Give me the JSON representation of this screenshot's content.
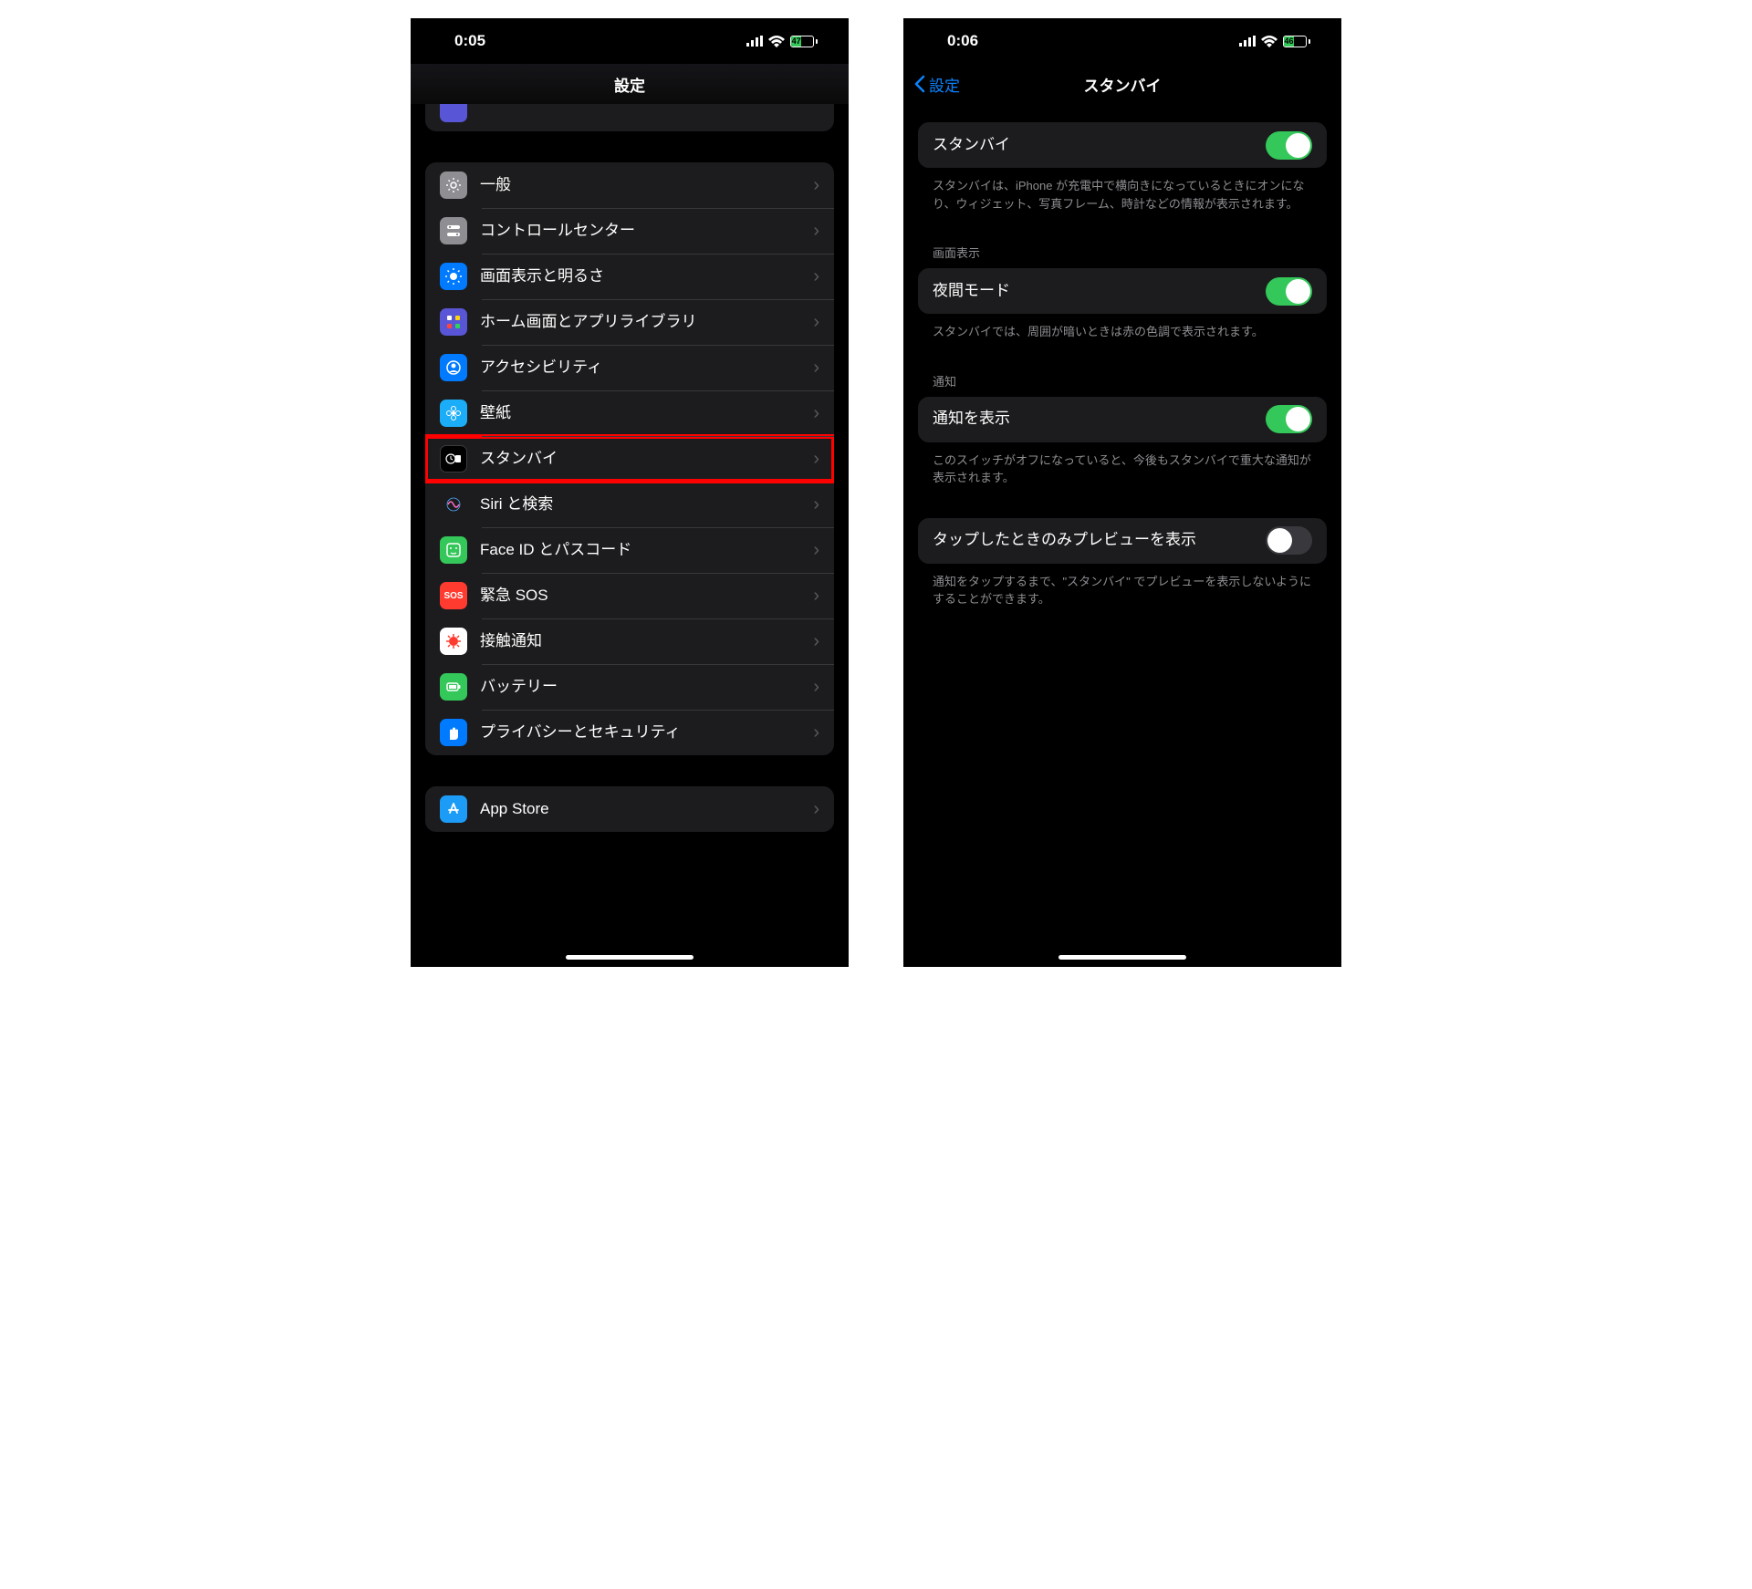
{
  "left": {
    "status": {
      "time": "0:05",
      "battery": "47"
    },
    "title": "設定",
    "items": [
      {
        "key": "general",
        "label": "一般",
        "icon": "gear",
        "bg": "bg-gray"
      },
      {
        "key": "control",
        "label": "コントロールセンター",
        "icon": "switches",
        "bg": "bg-gray2"
      },
      {
        "key": "display",
        "label": "画面表示と明るさ",
        "icon": "sun",
        "bg": "bg-blue"
      },
      {
        "key": "home",
        "label": "ホーム画面とアプリライブラリ",
        "icon": "grid",
        "bg": "bg-purple"
      },
      {
        "key": "accessibility",
        "label": "アクセシビリティ",
        "icon": "person",
        "bg": "bg-blue"
      },
      {
        "key": "wallpaper",
        "label": "壁紙",
        "icon": "flower",
        "bg": "bg-cyan"
      },
      {
        "key": "standby",
        "label": "スタンバイ",
        "icon": "clockcard",
        "bg": "bg-black",
        "highlight": true
      },
      {
        "key": "siri",
        "label": "Siri と検索",
        "icon": "siri",
        "bg": "bg-siri"
      },
      {
        "key": "faceid",
        "label": "Face ID とパスコード",
        "icon": "face",
        "bg": "bg-green"
      },
      {
        "key": "sos",
        "label": "緊急 SOS",
        "icon": "sos",
        "bg": "bg-red"
      },
      {
        "key": "exposure",
        "label": "接触通知",
        "icon": "virus",
        "bg": "bg-white"
      },
      {
        "key": "battery",
        "label": "バッテリー",
        "icon": "battery",
        "bg": "bg-green"
      },
      {
        "key": "privacy",
        "label": "プライバシーとセキュリティ",
        "icon": "hand",
        "bg": "bg-blue"
      }
    ],
    "next_group_first": {
      "label": "App Store",
      "icon": "appstore",
      "bg": "bg-appstore"
    }
  },
  "right": {
    "status": {
      "time": "0:06",
      "battery": "46"
    },
    "back_label": "設定",
    "title": "スタンバイ",
    "sections": [
      {
        "header": "",
        "rows": [
          {
            "key": "standby",
            "label": "スタンバイ",
            "toggle": true
          }
        ],
        "footer": "スタンバイは、iPhone が充電中で横向きになっているときにオンになり、ウィジェット、写真フレーム、時計などの情報が表示されます。"
      },
      {
        "header": "画面表示",
        "rows": [
          {
            "key": "night",
            "label": "夜間モード",
            "toggle": true
          }
        ],
        "footer": "スタンバイでは、周囲が暗いときは赤の色調で表示されます。"
      },
      {
        "header": "通知",
        "rows": [
          {
            "key": "show_notif",
            "label": "通知を表示",
            "toggle": true
          }
        ],
        "footer": "このスイッチがオフになっていると、今後もスタンバイで重大な通知が表示されます。"
      },
      {
        "header": "",
        "rows": [
          {
            "key": "tap_preview",
            "label": "タップしたときのみプレビューを表示",
            "toggle": false
          }
        ],
        "footer": "通知をタップするまで、\"スタンバイ\" でプレビューを表示しないようにすることができます。"
      }
    ]
  }
}
